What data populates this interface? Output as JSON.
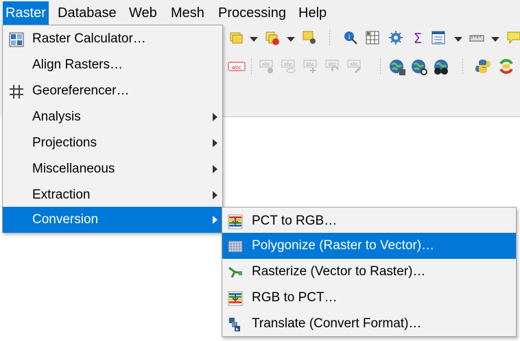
{
  "menubar": {
    "items": [
      {
        "label": "Raster",
        "active": true
      },
      {
        "label": "Database"
      },
      {
        "label": "Web"
      },
      {
        "label": "Mesh"
      },
      {
        "label": "Processing"
      },
      {
        "label": "Help"
      }
    ]
  },
  "toolbar_row2_labels": [
    "abc",
    "abc",
    "abc",
    "abc",
    "abc",
    "abc"
  ],
  "raster_menu": {
    "items": [
      {
        "label": "Raster Calculator…",
        "icon": "raster-calculator-icon"
      },
      {
        "label": "Align Rasters…"
      },
      {
        "label": "Georeferencer…",
        "icon": "georeferencer-icon"
      },
      {
        "label": "Analysis",
        "submenu": true
      },
      {
        "label": "Projections",
        "submenu": true
      },
      {
        "label": "Miscellaneous",
        "submenu": true
      },
      {
        "label": "Extraction",
        "submenu": true
      },
      {
        "label": "Conversion",
        "submenu": true,
        "highlighted": true
      }
    ]
  },
  "conversion_menu": {
    "items": [
      {
        "label": "PCT to RGB…",
        "icon": "pct-to-rgb-icon"
      },
      {
        "label": "Polygonize (Raster to Vector)…",
        "icon": "polygonize-icon",
        "highlighted": true
      },
      {
        "label": "Rasterize (Vector to Raster)…",
        "icon": "rasterize-icon"
      },
      {
        "label": "RGB to PCT…",
        "icon": "rgb-to-pct-icon"
      },
      {
        "label": "Translate (Convert Format)…",
        "icon": "translate-icon"
      }
    ]
  },
  "colors": {
    "highlight": "#0078d7",
    "menu_bg": "#f2f2f2"
  }
}
